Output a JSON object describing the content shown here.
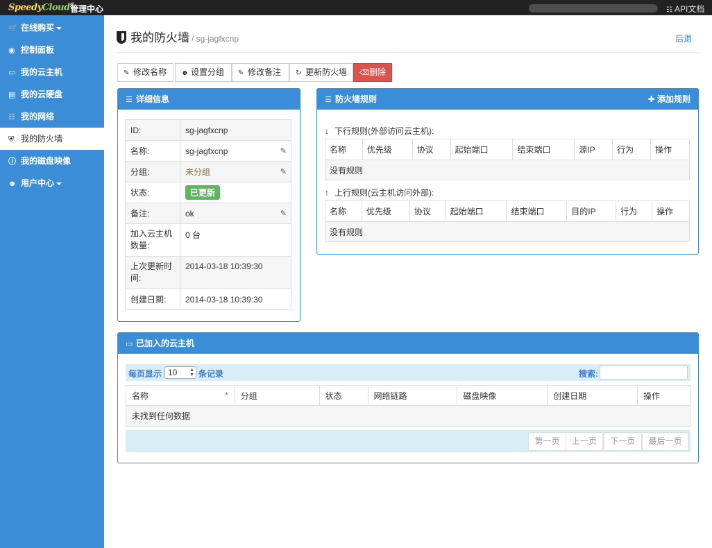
{
  "topbar": {
    "logo_text_a": "Speedy",
    "logo_text_b": "Cloud",
    "admin_title": "管理中心",
    "api_docs": "API文档"
  },
  "sidebar": {
    "items": [
      {
        "label": "在线购买",
        "icon": "cart-icon"
      },
      {
        "label": "控制面板",
        "icon": "dashboard-icon"
      },
      {
        "label": "我的云主机",
        "icon": "desktop-icon"
      },
      {
        "label": "我的云硬盘",
        "icon": "hdd-icon"
      },
      {
        "label": "我的网络",
        "icon": "sitemap-icon"
      },
      {
        "label": "我的防火墙",
        "icon": "shield-icon",
        "active": true
      },
      {
        "label": "我的磁盘映像",
        "icon": "info-icon"
      },
      {
        "label": "用户中心",
        "icon": "user-icon"
      }
    ]
  },
  "header": {
    "title": "我的防火墙",
    "subtitle": "/ sg-jagfxcnp",
    "back": "后退"
  },
  "toolbar": {
    "rename": "修改名称",
    "set_group": "设置分组",
    "edit_note": "修改备注",
    "update": "更新防火墙",
    "delete": "删除"
  },
  "details": {
    "heading": "详细信息",
    "rows": [
      {
        "k": "ID:",
        "v": "sg-jagfxcnp"
      },
      {
        "k": "名称:",
        "v": "sg-jagfxcnp"
      },
      {
        "k": "分组:",
        "v": "未分组"
      },
      {
        "k": "状态:",
        "v": "已更新"
      },
      {
        "k": "备注:",
        "v": "ok"
      },
      {
        "k": "加入云主机数量:",
        "v": "0 台"
      },
      {
        "k": "上次更新时间:",
        "v": "2014-03-18 10:39:30"
      },
      {
        "k": "创建日期:",
        "v": "2014-03-18 10:39:30"
      }
    ]
  },
  "rules": {
    "heading": "防火墙规则",
    "add": "添加规则",
    "inbound": {
      "title": "下行规则(外部访问云主机):",
      "columns": [
        "名称",
        "优先级",
        "协议",
        "起始端口",
        "结束端口",
        "源IP",
        "行为",
        "操作"
      ],
      "empty": "没有规则"
    },
    "outbound": {
      "title": "上行规则(云主机访问外部):",
      "columns": [
        "名称",
        "优先级",
        "协议",
        "起始端口",
        "结束端口",
        "目的IP",
        "行为",
        "操作"
      ],
      "empty": "没有规则"
    }
  },
  "vms": {
    "heading": "已加入的云主机",
    "length_label_a": "每页显示",
    "length_value": "10",
    "length_label_b": "条记录",
    "search_label": "搜索:",
    "columns": [
      "名称",
      "分组",
      "状态",
      "网络链路",
      "磁盘映像",
      "创建日期",
      "操作"
    ],
    "empty": "未找到任何数据",
    "pager": [
      "第一页",
      "上一页",
      "下一页",
      "最后一页"
    ]
  }
}
